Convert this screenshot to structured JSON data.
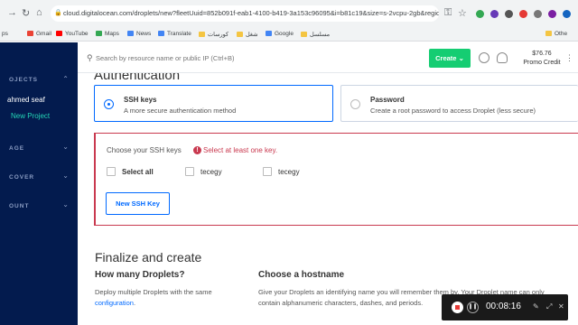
{
  "browser": {
    "url": "cloud.digitalocean.com/droplets/new?fleetUuid=852b091f-eab1-4100-b419-3a153c96095&i=b81c19&size=s-2vcpu-2gb&region...",
    "bookmarks": [
      {
        "label": "ps",
        "color": "#5f6368"
      },
      {
        "label": "Gmail",
        "color": "#ea4335"
      },
      {
        "label": "YouTube",
        "color": "#ff0000"
      },
      {
        "label": "Maps",
        "color": "#34a853"
      },
      {
        "label": "News",
        "color": "#4285f4"
      },
      {
        "label": "Translate",
        "color": "#4285f4"
      },
      {
        "label": "كورسات",
        "color": "#f4c542"
      },
      {
        "label": "شغل",
        "color": "#f4c542"
      },
      {
        "label": "Google",
        "color": "#4285f4"
      },
      {
        "label": "مسلسل",
        "color": "#f4c542"
      },
      {
        "label": "Othe",
        "color": "#f4c542"
      }
    ]
  },
  "sidebar": {
    "projects_heading": "OJECTS",
    "user_name": "ahmed seaf",
    "new_project": "New Project",
    "manage_heading": "AGE",
    "discover_heading": "COVER",
    "account_heading": "OUNT"
  },
  "header": {
    "search_placeholder": "Search by resource name or public IP (Ctrl+B)",
    "create_label": "Create",
    "balance": "$76.76",
    "balance_label": "Promo Credit"
  },
  "auth": {
    "title": "Authentication",
    "options": [
      {
        "title": "SSH keys",
        "desc": "A more secure authentication method",
        "selected": true
      },
      {
        "title": "Password",
        "desc": "Create a root password to access Droplet (less secure)",
        "selected": false
      }
    ],
    "choose_label": "Choose your SSH keys",
    "error": "Select at least one key.",
    "select_all": "Select all",
    "keys": [
      "tecegy",
      "tecegy"
    ],
    "new_key_button": "New SSH Key"
  },
  "finalize": {
    "title": "Finalize and create",
    "droplets_heading": "How many Droplets?",
    "droplets_desc_1": "Deploy multiple Droplets with the same",
    "droplets_desc_link": "configuration",
    "hostname_heading": "Choose a hostname",
    "hostname_desc_1": "Give your Droplets an identifying name you will remember them by. Your Droplet name can only",
    "hostname_desc_2": "contain alphanumeric characters, dashes, and periods."
  },
  "recorder": {
    "time": "00:08:16"
  },
  "colors": {
    "sidebar_bg": "#031b4e",
    "accent_blue": "#0069ff",
    "create_green": "#15cd72",
    "error_red": "#c9394f"
  }
}
